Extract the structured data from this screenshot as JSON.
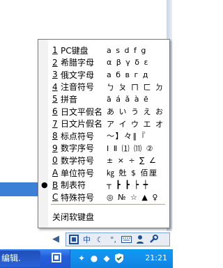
{
  "menu": {
    "items": [
      {
        "key": "1",
        "label": "PC键盘",
        "sample": "a s d f g",
        "checked": false
      },
      {
        "key": "2",
        "label": "希腊字母",
        "sample": "α β γ δ ε",
        "checked": false
      },
      {
        "key": "3",
        "label": "俄文字母",
        "sample": "а б в г д",
        "checked": false
      },
      {
        "key": "4",
        "label": "注音符号",
        "sample": "ㄅ ㄆ ㄇ ㄈ ㄉ",
        "checked": false
      },
      {
        "key": "5",
        "label": "拼音",
        "sample": "ā á ǎ à ē",
        "checked": false
      },
      {
        "key": "6",
        "label": "日文平假名",
        "sample": "あ い う え お",
        "checked": false
      },
      {
        "key": "7",
        "label": "日文片假名",
        "sample": "ア イ ウ エ オ",
        "checked": false
      },
      {
        "key": "8",
        "label": "标点符号",
        "sample": "～】々‖『",
        "checked": false
      },
      {
        "key": "9",
        "label": "数字序号",
        "sample": "Ⅰ Ⅱ ⑴ ⑾ ②",
        "checked": false
      },
      {
        "key": "0",
        "label": "数学符号",
        "sample": "± × ÷ ∑ ∠",
        "checked": false
      },
      {
        "key": "A",
        "label": "单位符号",
        "sample": "㎏ 兙 $ 佰厘",
        "checked": false
      },
      {
        "key": "B",
        "label": "制表符",
        "sample": "┬ ┣ ┣ ┝ ┿",
        "checked": true
      },
      {
        "key": "C",
        "label": "特殊符号",
        "sample": "◎ № ☆ ▲ ♀",
        "checked": false
      }
    ],
    "close_label": "关闭软键盘"
  },
  "ime_toolbar": {
    "mode_label": "中",
    "buttons": [
      "ime-logo-icon",
      "moon-icon",
      "punctuation-icon",
      "keyboard-icon",
      "user-icon",
      "wrench-icon"
    ]
  },
  "taskbar": {
    "task_label": "编辑.",
    "clock": "21:21"
  }
}
